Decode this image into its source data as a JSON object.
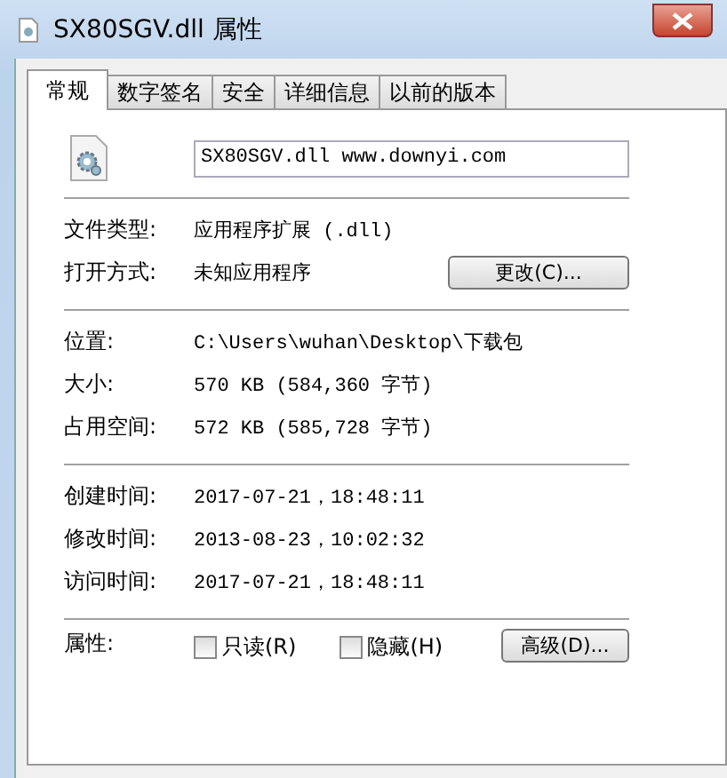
{
  "window": {
    "title": "SX80SGV.dll 属性"
  },
  "tabs": [
    {
      "label": "常规",
      "selected": true
    },
    {
      "label": "数字签名",
      "selected": false
    },
    {
      "label": "安全",
      "selected": false
    },
    {
      "label": "详细信息",
      "selected": false
    },
    {
      "label": "以前的版本",
      "selected": false
    }
  ],
  "file_name": "SX80SGV.dll www.downyi.com",
  "sections": [
    {
      "rows": [
        {
          "label": "文件类型:",
          "value": "应用程序扩展 (.dll)"
        },
        {
          "label": "打开方式:",
          "value": "未知应用程序",
          "button": "更改(C)..."
        }
      ]
    },
    {
      "rows": [
        {
          "label": "位置:",
          "value": "C:\\Users\\wuhan\\Desktop\\下载包"
        },
        {
          "label": "大小:",
          "value": "570 KB (584,360 字节)"
        },
        {
          "label": "占用空间:",
          "value": "572 KB (585,728 字节)"
        }
      ]
    },
    {
      "rows": [
        {
          "label": "创建时间:",
          "value": "2017-07-21，18:48:11"
        },
        {
          "label": "修改时间:",
          "value": "2013-08-23，10:02:32"
        },
        {
          "label": "访问时间:",
          "value": "2017-07-21，18:48:11"
        }
      ]
    }
  ],
  "attributes": {
    "label": "属性:",
    "checkboxes": [
      {
        "label": "只读(R)",
        "checked": false
      },
      {
        "label": "隐藏(H)",
        "checked": false
      }
    ],
    "button": "高级(D)..."
  }
}
